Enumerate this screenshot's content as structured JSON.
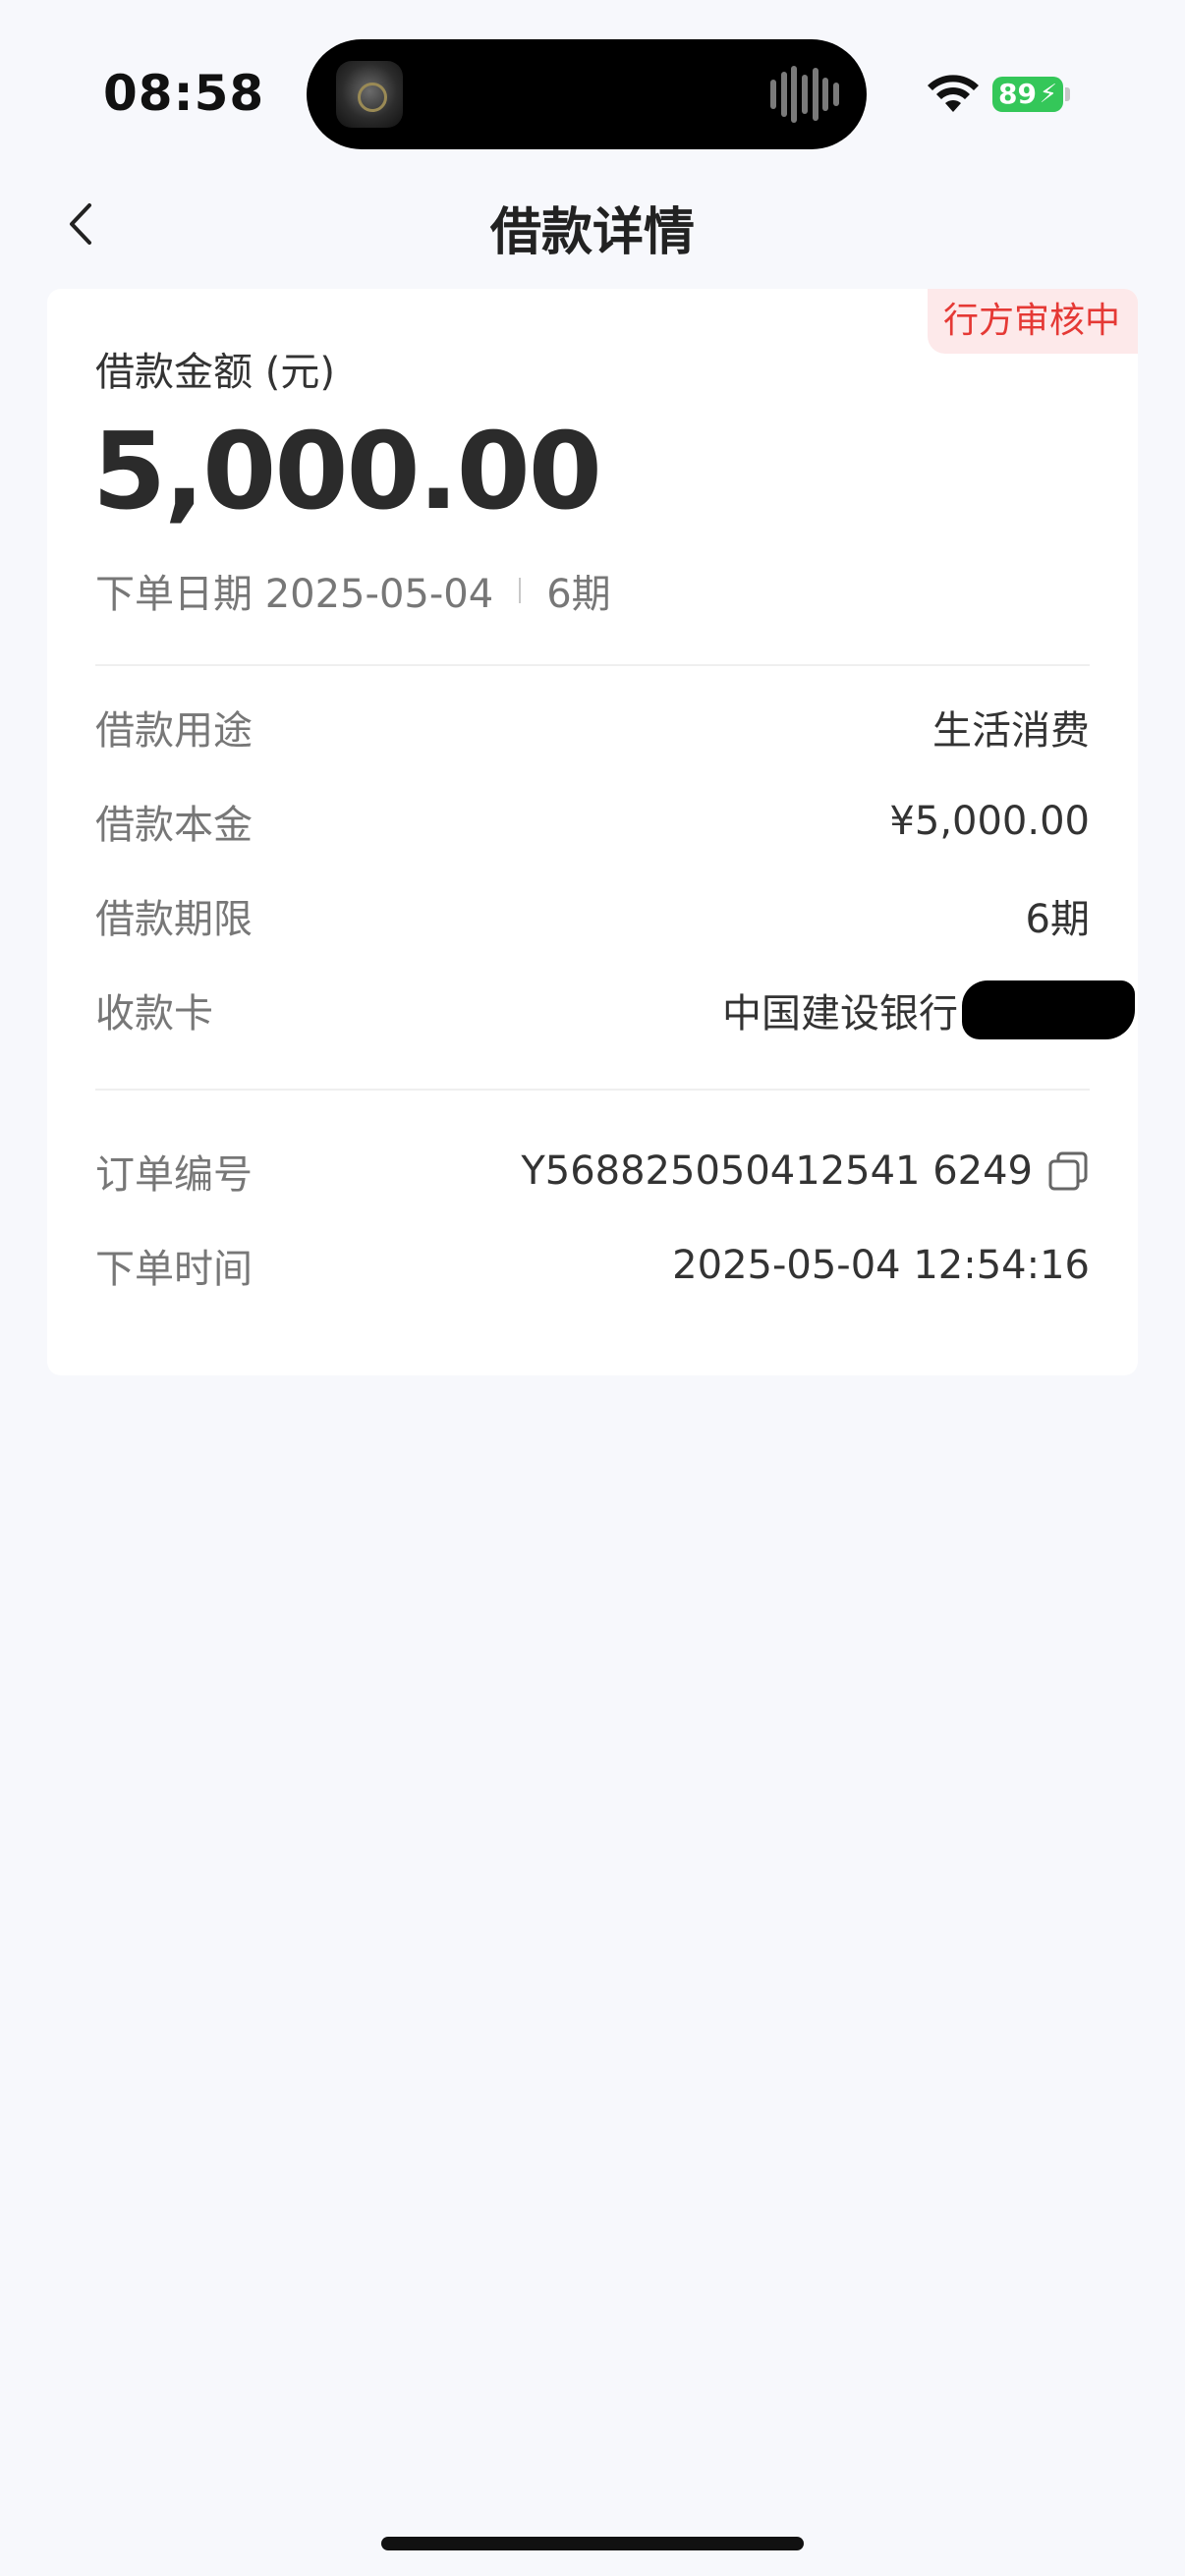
{
  "status_bar": {
    "time": "08:58",
    "battery": "89"
  },
  "nav": {
    "title": "借款详情"
  },
  "card": {
    "status_badge": "行方审核中",
    "amount_label": "借款金额 (元)",
    "amount_value": "5,000.00",
    "order_date": "下单日期 2025-05-04",
    "order_periods": "6期",
    "details": [
      {
        "label": "借款用途",
        "value": "生活消费"
      },
      {
        "label": "借款本金",
        "value": "¥5,000.00"
      },
      {
        "label": "借款期限",
        "value": "6期"
      },
      {
        "label": "收款卡",
        "value": "中国建设银行"
      }
    ],
    "order_info": [
      {
        "label": "订单编号",
        "value": "Y568825050412541 6249"
      },
      {
        "label": "下单时间",
        "value": "2025-05-04 12:54:16"
      }
    ]
  },
  "colors": {
    "page_background": "#f7f8fc",
    "badge_text": "#e53935",
    "badge_background": "#fde9ea",
    "battery": "#34c759"
  }
}
